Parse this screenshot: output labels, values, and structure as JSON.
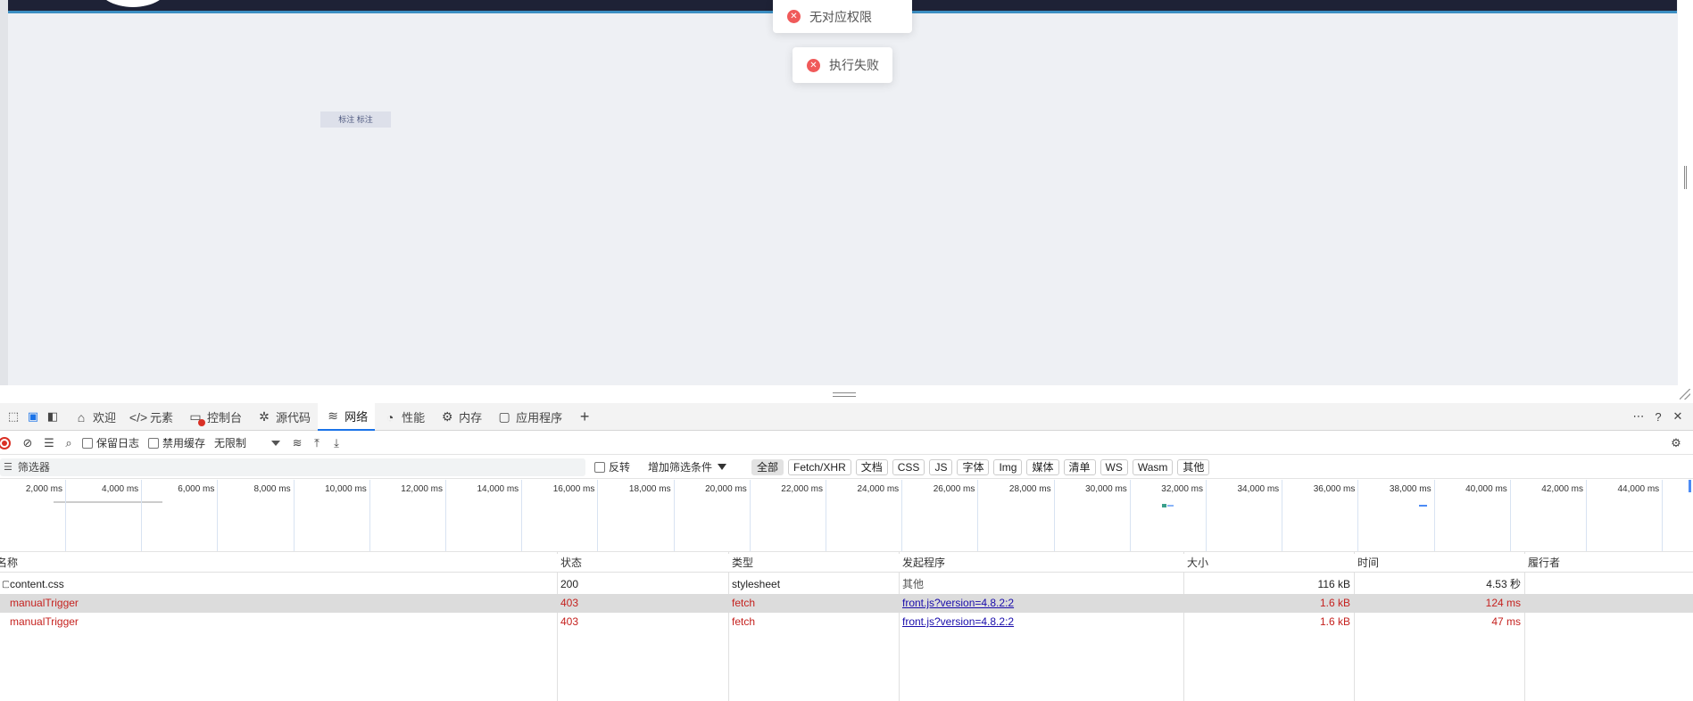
{
  "page": {
    "chip_text": "标注 标注",
    "toasts": [
      "无对应权限",
      "执行失败"
    ]
  },
  "devtools": {
    "tabs": [
      {
        "label": "欢迎",
        "icon": "home-icon"
      },
      {
        "label": "元素",
        "icon": "code-icon"
      },
      {
        "label": "控制台",
        "icon": "console-icon"
      },
      {
        "label": "源代码",
        "icon": "bug-icon"
      },
      {
        "label": "网络",
        "icon": "wifi-icon"
      },
      {
        "label": "性能",
        "icon": "gauge-icon"
      },
      {
        "label": "内存",
        "icon": "gear-icon"
      },
      {
        "label": "应用程序",
        "icon": "window-icon"
      }
    ],
    "active_tab": "网络",
    "toolbar": {
      "preserve_log": "保留日志",
      "disable_cache": "禁用缓存",
      "throttle": "无限制"
    },
    "filter": {
      "placeholder": "筛选器",
      "invert": "反转",
      "more_filters": "增加筛选条件",
      "types": [
        "全部",
        "Fetch/XHR",
        "文档",
        "CSS",
        "JS",
        "字体",
        "Img",
        "媒体",
        "清单",
        "WS",
        "Wasm",
        "其他"
      ],
      "active_type": "全部"
    },
    "timeline": {
      "ticks": [
        "2,000 ms",
        "4,000 ms",
        "6,000 ms",
        "8,000 ms",
        "10,000 ms",
        "12,000 ms",
        "14,000 ms",
        "16,000 ms",
        "18,000 ms",
        "20,000 ms",
        "22,000 ms",
        "24,000 ms",
        "26,000 ms",
        "28,000 ms",
        "30,000 ms",
        "32,000 ms",
        "34,000 ms",
        "36,000 ms",
        "38,000 ms",
        "40,000 ms",
        "42,000 ms",
        "44,000 ms"
      ]
    },
    "table": {
      "headers": [
        "名称",
        "状态",
        "类型",
        "发起程序",
        "大小",
        "时间",
        "履行者"
      ],
      "rows": [
        {
          "name": "content.css",
          "status": "200",
          "type": "stylesheet",
          "initiator": "其他",
          "size": "116 kB",
          "time": "4.53 秒",
          "error": false,
          "selected": false
        },
        {
          "name": "manualTrigger",
          "status": "403",
          "type": "fetch",
          "initiator": "front.js?version=4.8.2:2",
          "size": "1.6 kB",
          "time": "124 ms",
          "error": true,
          "selected": true
        },
        {
          "name": "manualTrigger",
          "status": "403",
          "type": "fetch",
          "initiator": "front.js?version=4.8.2:2",
          "size": "1.6 kB",
          "time": "47 ms",
          "error": true,
          "selected": false
        }
      ]
    },
    "colors": {
      "accent": "#1a73e8",
      "error": "#c5221f",
      "toast_error": "#f05a5a"
    }
  }
}
